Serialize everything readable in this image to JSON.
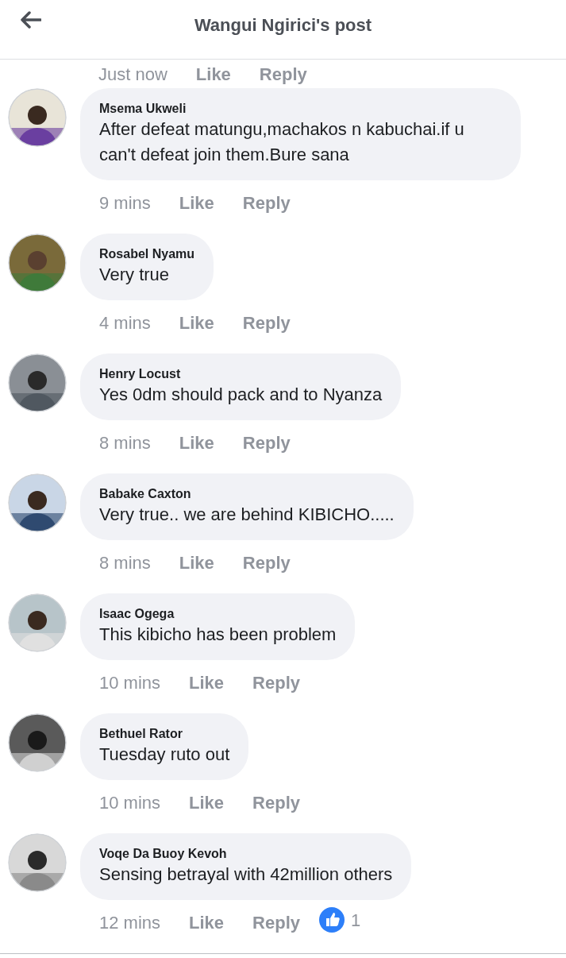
{
  "header": {
    "title": "Wangui Ngirici's post"
  },
  "previous_meta": {
    "time": "Just now",
    "like": "Like",
    "reply": "Reply"
  },
  "comments": [
    {
      "author": "Msema Ukweli",
      "text": "After defeat matungu,machakos n kabuchai.if u can't defeat join them.Bure sana",
      "time": "9 mins",
      "like": "Like",
      "reply": "Reply"
    },
    {
      "author": "Rosabel Nyamu",
      "text": "Very true",
      "time": "4 mins",
      "like": "Like",
      "reply": "Reply"
    },
    {
      "author": "Henry Locust",
      "text": "Yes 0dm should pack and to Nyanza",
      "time": "8 mins",
      "like": "Like",
      "reply": "Reply"
    },
    {
      "author": "Babake Caxton",
      "text": "Very true.. we are behind KIBICHO.....",
      "time": "8 mins",
      "like": "Like",
      "reply": "Reply"
    },
    {
      "author": "Isaac Ogega",
      "text": "This kibicho has been problem",
      "time": "10 mins",
      "like": "Like",
      "reply": "Reply"
    },
    {
      "author": "Bethuel Rator",
      "text": "Tuesday ruto out",
      "time": "10 mins",
      "like": "Like",
      "reply": "Reply"
    },
    {
      "author": "Voqe Da Buoy Kevoh",
      "text": "Sensing betrayal with 42million others",
      "time": "12 mins",
      "like": "Like",
      "reply": "Reply",
      "reactions": {
        "count": "1"
      }
    }
  ]
}
